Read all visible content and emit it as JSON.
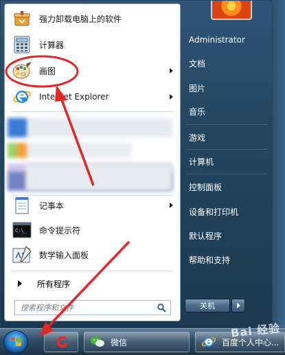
{
  "start_menu": {
    "pinned": [
      {
        "label": "强力卸载电脑上的软件",
        "icon": "uninstaller-box-icon",
        "has_submenu": false
      },
      {
        "label": "计算器",
        "icon": "calculator-icon",
        "has_submenu": false
      },
      {
        "label": "画图",
        "icon": "paint-palette-icon",
        "has_submenu": true
      },
      {
        "label": "Internet Explorer",
        "icon": "internet-explorer-icon",
        "has_submenu": true
      }
    ],
    "recent": [
      {
        "label": "记事本",
        "icon": "notepad-icon",
        "has_submenu": true
      },
      {
        "label": "命令提示符",
        "icon": "command-prompt-icon",
        "has_submenu": false
      },
      {
        "label": "数学输入面板",
        "icon": "math-input-panel-icon",
        "has_submenu": false
      }
    ],
    "all_programs": "所有程序",
    "search_placeholder": "搜索程序和文件",
    "right_items": [
      {
        "label": "Administrator"
      },
      {
        "label": "文档"
      },
      {
        "label": "图片"
      },
      {
        "label": "音乐"
      },
      {
        "label": "游戏"
      },
      {
        "label": "计算机"
      },
      {
        "label": "控制面板"
      },
      {
        "label": "设备和打印机"
      },
      {
        "label": "默认程序"
      },
      {
        "label": "帮助和支持"
      }
    ],
    "shutdown_label": "关机"
  },
  "taskbar": {
    "items": [
      {
        "label": "微信",
        "icon": "wechat-icon"
      },
      {
        "label": "百度个人中心...",
        "icon": "internet-explorer-icon"
      }
    ]
  },
  "watermark": "Bai 经验",
  "colors": {
    "annotation_red": "#e32626",
    "menu_right_bg": "#23455f",
    "taskbar": "#2f4d66"
  }
}
